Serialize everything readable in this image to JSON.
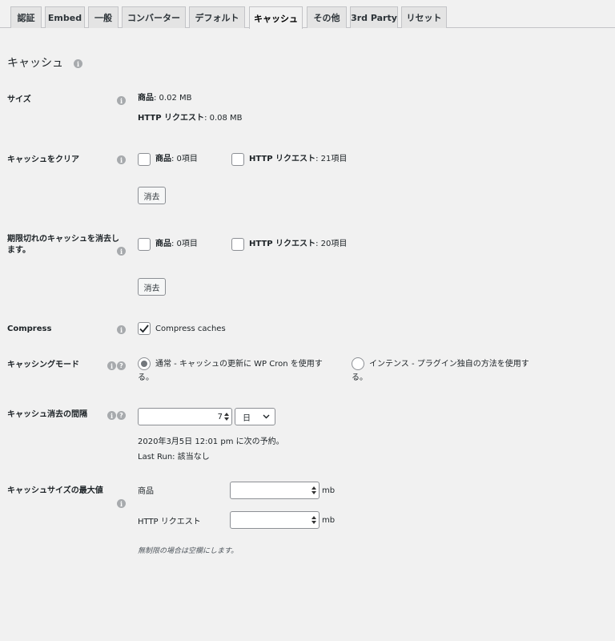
{
  "tabs": [
    "認証",
    "Embed",
    "一般",
    "コンバーター",
    "デフォルト",
    "キャッシュ",
    "その他",
    "3rd Party",
    "リセット"
  ],
  "page": {
    "title": "キャッシュ"
  },
  "size": {
    "label": "サイズ",
    "products_label": "商品",
    "products_value": ": 0.02 MB",
    "http_label": "HTTP リクエスト",
    "http_value": ": 0.08 MB"
  },
  "clear": {
    "label": "キャッシュをクリア",
    "products_label": "商品",
    "products_value": ": 0項目",
    "http_label": "HTTP リクエスト",
    "http_value": ": 21項目",
    "button": "消去"
  },
  "expired": {
    "label_line1": "期限切れのキャッシュを消去し",
    "label_line2": "ます。",
    "products_label": "商品",
    "products_value": ": 0項目",
    "http_label": "HTTP リクエスト",
    "http_value": ": 20項目",
    "button": "消去"
  },
  "compress": {
    "label": "Compress",
    "option": "Compress caches",
    "checked": true
  },
  "mode": {
    "label": "キャッシングモード",
    "normal_line1": "通常 - キャッシュの更新に WP Cron を使用す",
    "normal_line2": "る。",
    "intense_line1": "インテンス - プラグイン独自の方法を使用す",
    "intense_line2": "る。",
    "selected": "normal"
  },
  "interval": {
    "label": "キャッシュ消去の間隔",
    "value": "7",
    "unit": "日",
    "next": "2020年3月5日 12:01 pm に次の予約。",
    "last_run": "Last Run: 該当なし"
  },
  "max_size": {
    "label": "キャッシュサイズの最大値",
    "products_label": "商品",
    "http_label": "HTTP リクエスト",
    "unit": "mb",
    "note": "無制限の場合は空欄にします。"
  },
  "icons": {
    "info": "i",
    "help": "?"
  }
}
